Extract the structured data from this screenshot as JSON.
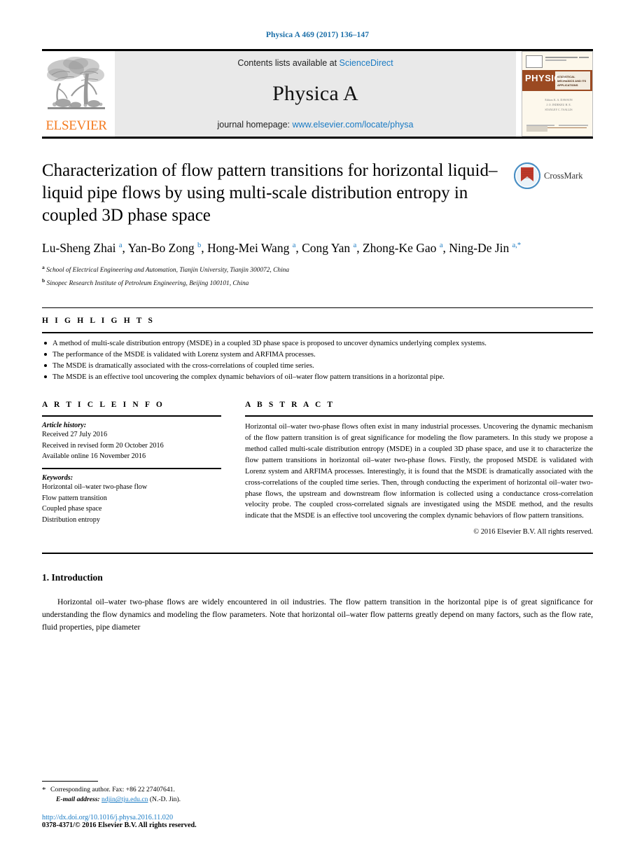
{
  "running_head": "Physica A 469 (2017) 136–147",
  "masthead": {
    "elsevier_wordmark": "ELSEVIER",
    "contents_prefix": "Contents lists available at ",
    "contents_link": "ScienceDirect",
    "journal_name": "Physica A",
    "homepage_prefix": "journal homepage: ",
    "homepage_link": "www.elsevier.com/locate/physa",
    "cover": {
      "title": "PHYSICA",
      "subtitle": "STATISTICAL MECHANICS AND ITS APPLICATIONS",
      "mid_text": "Editors K. A. DAWSON J. O. INDEKEU H. E. STANLEY C. TSALLIS"
    }
  },
  "article": {
    "title": "Characterization of flow pattern transitions for horizontal liquid–liquid pipe flows by using multi-scale distribution entropy in coupled 3D phase space",
    "crossmark_label": "CrossMark",
    "authors_html": "Lu-Sheng Zhai <sup>a</sup>, Yan-Bo Zong <sup>b</sup>, Hong-Mei Wang <sup>a</sup>, Cong Yan <sup>a</sup>, Zhong-Ke Gao <sup>a</sup>, Ning-De Jin <sup>a,*</sup>",
    "affiliations": [
      {
        "marker": "a",
        "text": "School of Electrical Engineering and Automation, Tianjin University, Tianjin 300072, China"
      },
      {
        "marker": "b",
        "text": "Sinopec Research Institute of Petroleum Engineering, Beijing 100101, China"
      }
    ]
  },
  "highlights": {
    "heading": "H I G H L I G H T S",
    "items": [
      "A method of multi-scale distribution entropy (MSDE) in a coupled 3D phase space is proposed to uncover dynamics underlying complex systems.",
      "The performance of the MSDE is validated with Lorenz system and ARFIMA processes.",
      "The MSDE is dramatically associated with the cross-correlations of coupled time series.",
      "The MSDE is an effective tool uncovering the complex dynamic behaviors of oil–water flow pattern transitions in a horizontal pipe."
    ]
  },
  "article_info": {
    "heading": "A R T I C L E   I N F O",
    "history_label": "Article history:",
    "history": [
      "Received 27 July 2016",
      "Received in revised form 20 October 2016",
      "Available online 16 November 2016"
    ],
    "keywords_label": "Keywords:",
    "keywords": [
      "Horizontal oil–water two-phase flow",
      "Flow pattern transition",
      "Coupled phase space",
      "Distribution entropy"
    ]
  },
  "abstract": {
    "heading": "A B S T R A C T",
    "body": "Horizontal oil–water two-phase flows often exist in many industrial processes. Uncovering the dynamic mechanism of the flow pattern transition is of great significance for modeling the flow parameters. In this study we propose a method called multi-scale distribution entropy (MSDE) in a coupled 3D phase space, and use it to characterize the flow pattern transitions in horizontal oil–water two-phase flows. Firstly, the proposed MSDE is validated with Lorenz system and ARFIMA processes. Interestingly, it is found that the MSDE is dramatically associated with the cross-correlations of the coupled time series. Then, through conducting the experiment of horizontal oil–water two-phase flows, the upstream and downstream flow information is collected using a conductance cross-correlation velocity probe. The coupled cross-correlated signals are investigated using the MSDE method, and the results indicate that the MSDE is an effective tool uncovering the complex dynamic behaviors of flow pattern transitions.",
    "copyright": "© 2016 Elsevier B.V. All rights reserved."
  },
  "introduction": {
    "heading": "1.  Introduction",
    "paragraph": "Horizontal oil–water two-phase flows are widely encountered in oil industries. The flow pattern transition in the horizontal pipe is of great significance for understanding the flow dynamics and modeling the flow parameters. Note that horizontal oil–water flow patterns greatly depend on many factors, such as the flow rate, fluid properties, pipe diameter"
  },
  "footnote": {
    "corresponding": "Corresponding author. Fax: +86 22 27407641.",
    "email_label": "E-mail address:",
    "email": "ndjin@tju.edu.cn",
    "email_suffix": "(N.-D. Jin).",
    "doi": "http://dx.doi.org/10.1016/j.physa.2016.11.020",
    "issn": "0378-4371/© 2016 Elsevier B.V. All rights reserved."
  },
  "colors": {
    "link_blue": "#1a7bc4",
    "running_head_blue": "#1a6ea8",
    "elsevier_orange": "#F47B20",
    "band_grey": "#e9e9e9",
    "cover_brown": "#9B4A22",
    "crossmark_blue": "#4a8fc4",
    "crossmark_red": "#C0392B"
  }
}
